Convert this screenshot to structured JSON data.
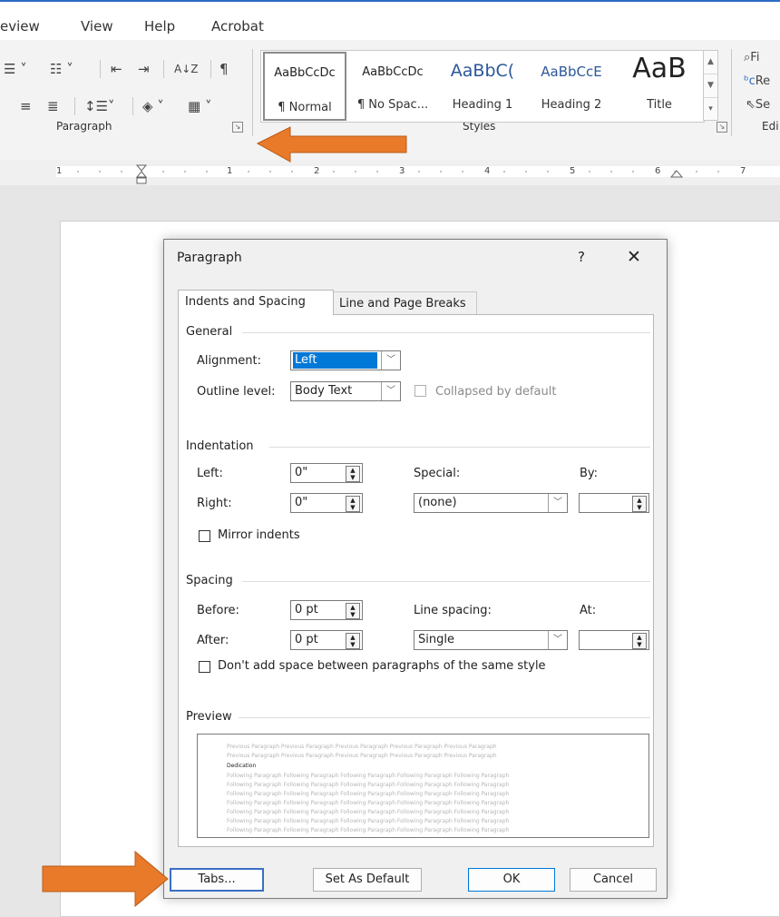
{
  "tabs": [
    "eview",
    "View",
    "Help",
    "Acrobat"
  ],
  "ribbon": {
    "paragraph_label": "Paragraph",
    "styles_label": "Styles",
    "editing_label": "Edi",
    "sort_glyph": "A↓Z",
    "pilcrow_glyph": "¶",
    "find_label": "Fi",
    "replace_label": "Re",
    "select_label": "Se",
    "styles": [
      {
        "sample": "AaBbCcDc",
        "name": "¶ Normal"
      },
      {
        "sample": "AaBbCcDc",
        "name": "¶ No Spac..."
      },
      {
        "sample": "AaBbC(",
        "name": "Heading 1"
      },
      {
        "sample": "AaBbCcE",
        "name": "Heading 2"
      },
      {
        "sample": "AaB",
        "name": "Title"
      }
    ],
    "heading_color": "#2b579a"
  },
  "ruler": {
    "numbers": [
      "1",
      "1",
      "2",
      "3",
      "4",
      "5",
      "6",
      "7"
    ]
  },
  "dialog": {
    "title": "Paragraph",
    "help": "?",
    "close": "✕",
    "tab_indents": "Indents and Spacing",
    "tab_breaks": "Line and Page Breaks",
    "general": "General",
    "alignment_label": "Alignment:",
    "alignment_value": "Left",
    "outline_label": "Outline level:",
    "outline_value": "Body Text",
    "collapsed_label": "Collapsed by default",
    "indentation": "Indentation",
    "left_label": "Left:",
    "left_value": "0\"",
    "right_label": "Right:",
    "right_value": "0\"",
    "special_label": "Special:",
    "special_value": "(none)",
    "by_label": "By:",
    "mirror_label": "Mirror indents",
    "spacing": "Spacing",
    "before_label": "Before:",
    "before_value": "0 pt",
    "after_label": "After:",
    "after_value": "0 pt",
    "line_spacing_label": "Line spacing:",
    "line_spacing_value": "Single",
    "at_label": "At:",
    "dont_add_label": "Don't add space between paragraphs of the same style",
    "preview": "Preview",
    "preview_lines": [
      "Previous Paragraph Previous Paragraph Previous Paragraph Previous Paragraph Previous Paragraph",
      "Previous Paragraph Previous Paragraph Previous Paragraph Previous Paragraph Previous Paragraph",
      "Dedication",
      "Following Paragraph Following Paragraph Following Paragraph Following Paragraph Following Paragraph",
      "Following Paragraph Following Paragraph Following Paragraph Following Paragraph Following Paragraph",
      "Following Paragraph Following Paragraph Following Paragraph Following Paragraph Following Paragraph",
      "Following Paragraph Following Paragraph Following Paragraph Following Paragraph Following Paragraph",
      "Following Paragraph Following Paragraph Following Paragraph Following Paragraph Following Paragraph",
      "Following Paragraph Following Paragraph Following Paragraph Following Paragraph Following Paragraph",
      "Following Paragraph Following Paragraph Following Paragraph Following Paragraph Following Paragraph"
    ],
    "btn_tabs": "Tabs...",
    "btn_default": "Set As Default",
    "btn_ok": "OK",
    "btn_cancel": "Cancel"
  },
  "colors": {
    "arrow": "#e87a2a",
    "selection": "#0078d7",
    "accent": "#2b6cc4"
  }
}
